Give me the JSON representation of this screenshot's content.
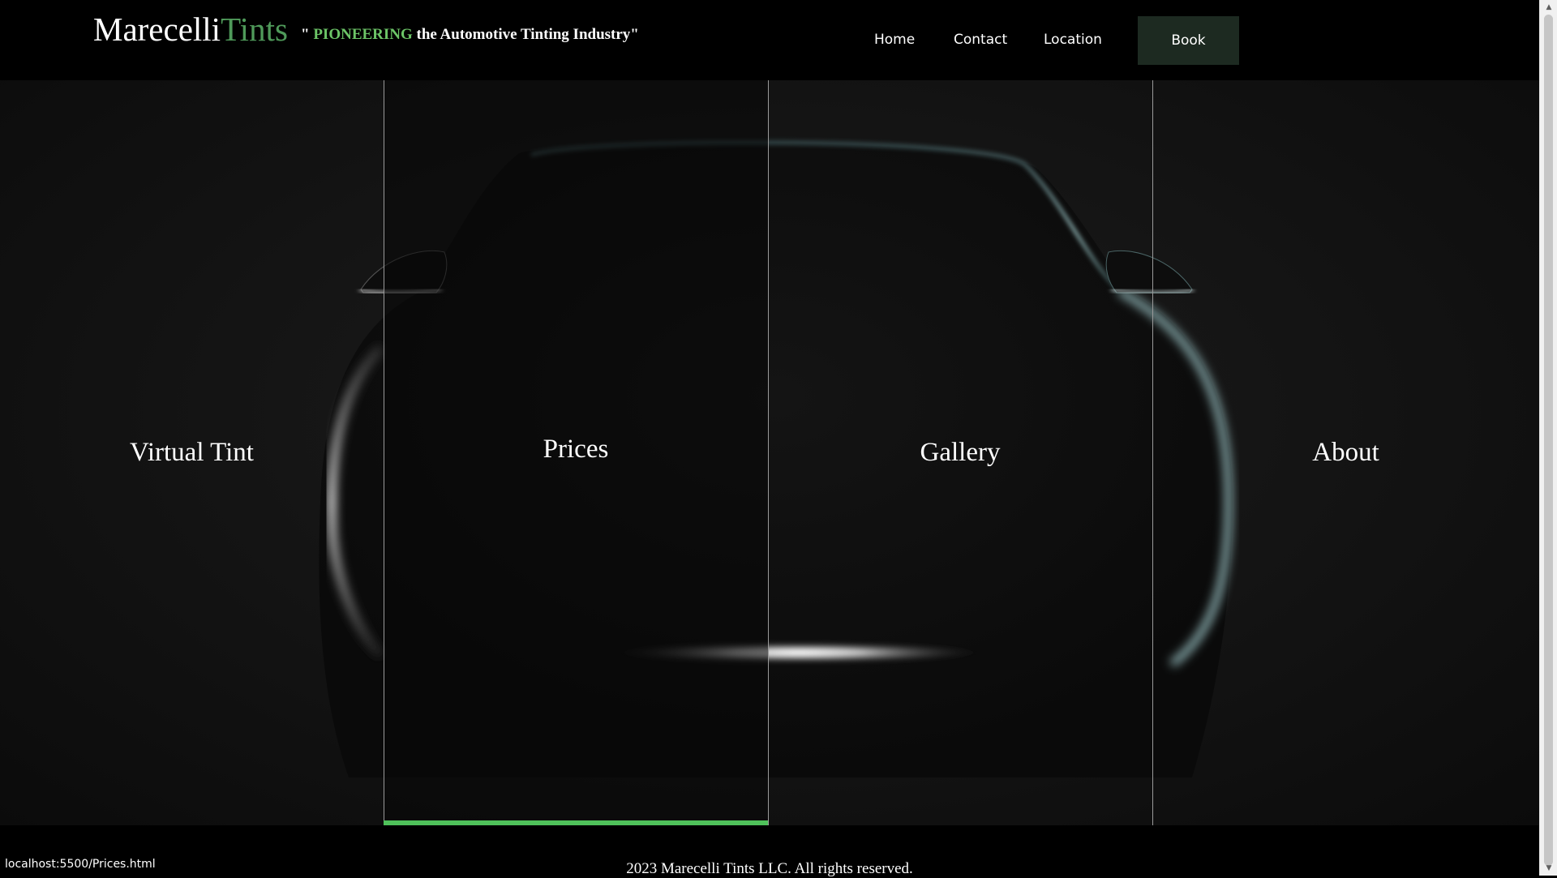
{
  "header": {
    "brand_primary": "Marecelli",
    "brand_secondary": "Tints",
    "tagline_open": "\" ",
    "tagline_highlight": "PIONEERING",
    "tagline_rest": " the Automotive Tinting Industry\""
  },
  "nav": {
    "items": [
      {
        "label": "Home"
      },
      {
        "label": "Contact"
      },
      {
        "label": "Location"
      }
    ],
    "book_label": "Book"
  },
  "hero": {
    "panels": [
      {
        "label": "Virtual Tint"
      },
      {
        "label": "Prices"
      },
      {
        "label": "Gallery"
      },
      {
        "label": "About"
      }
    ],
    "active_panel": "Prices"
  },
  "footer": {
    "copyright": "2023 Marecelli Tints LLC. All rights reserved."
  },
  "status_bar": {
    "url": "localhost:5500/Prices.html"
  },
  "colors": {
    "accent_green": "#4fc15a",
    "brand_green": "#4f9a5a",
    "book_bg": "#1d2a21"
  }
}
